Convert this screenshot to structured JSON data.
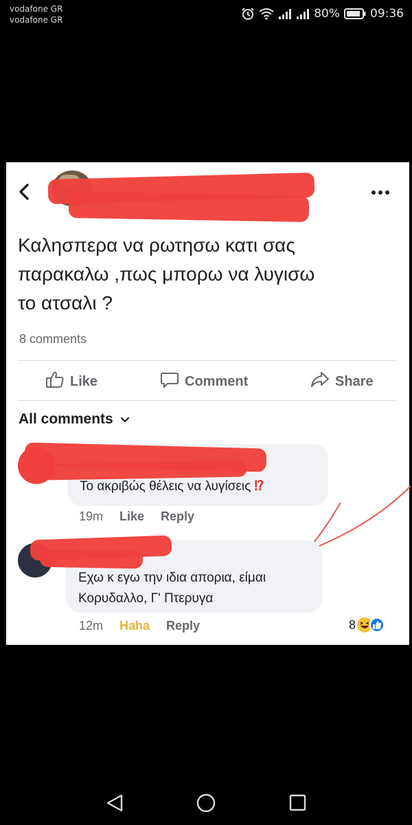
{
  "status_bar": {
    "carrier_1": "vodafone GR",
    "carrier_2": "vodafone GR",
    "battery": "80%",
    "time": "09:36"
  },
  "post": {
    "text_line_1": "Καλησπερα να ρωτησω κατι σας",
    "text_line_2": "παρακαλω ,πως μπορω να λυγισω",
    "text_line_3": "το ατσαλι ?",
    "comments_count": "8 comments"
  },
  "actions": {
    "like": "Like",
    "comment": "Comment",
    "share": "Share"
  },
  "comments_section": {
    "header": "All comments"
  },
  "comments": [
    {
      "text": "Το ακριβώς θέλεις να λυγίσεις",
      "emoji": "⁉",
      "time": "19m",
      "like": "Like",
      "reply": "Reply"
    },
    {
      "text_line_1": "Εχω κ εγω την ιδια απορια, είμαι",
      "text_line_2": "Κορυδαλλο, Γ' Πτερυγα",
      "time": "12m",
      "reaction_label": "Haha",
      "reply": "Reply",
      "reaction_count": "8"
    }
  ],
  "colors": {
    "redaction": "#f0413c",
    "haha": "#e3b33a",
    "like_blue": "#1877f2",
    "muted": "#65676b"
  },
  "icons": [
    "back-icon",
    "more-icon",
    "like-icon",
    "comment-icon",
    "share-icon",
    "chevron-down-icon",
    "alarm-icon",
    "wifi-icon",
    "signal-icon",
    "battery-icon",
    "nav-back-icon",
    "nav-home-icon",
    "nav-recents-icon"
  ]
}
